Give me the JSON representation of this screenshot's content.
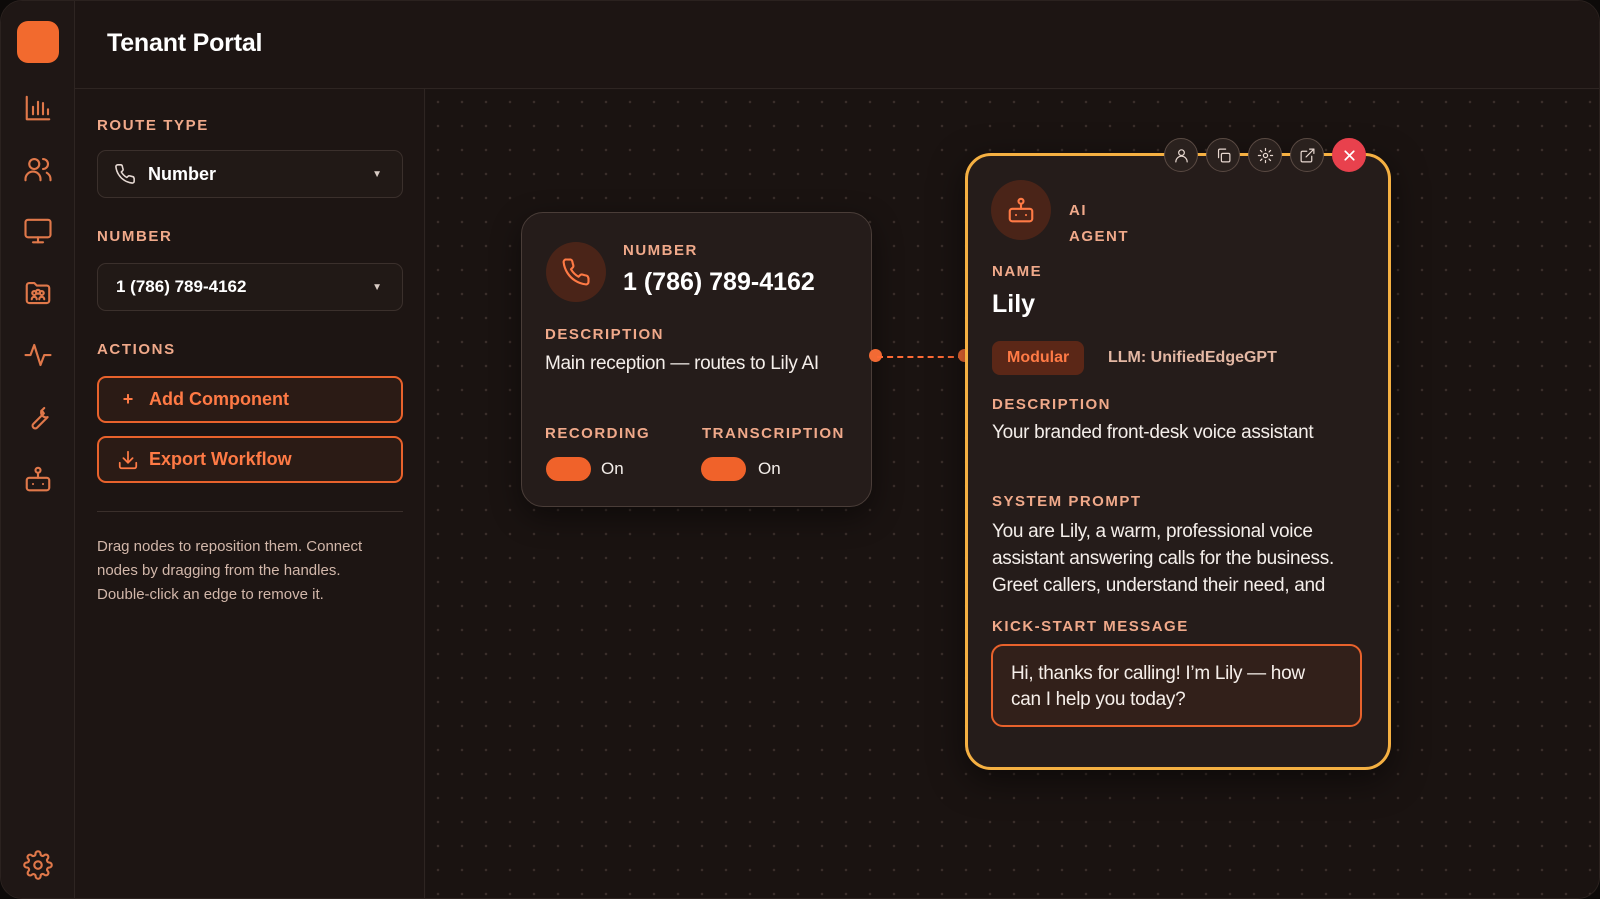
{
  "header": {
    "title": "Tenant Portal"
  },
  "rail": {
    "items": [
      "analytics",
      "users",
      "monitor",
      "team-folder",
      "activity",
      "tools",
      "agents"
    ],
    "footer": "settings"
  },
  "panel": {
    "route_type_label": "ROUTE TYPE",
    "route_type_value": "Number",
    "number_label": "NUMBER",
    "number_value": "1 (786) 789-4162",
    "actions_label": "ACTIONS",
    "add_component": "Add Component",
    "add_component_icon": "+",
    "export_workflow": "Export Workflow",
    "hint": "Drag nodes to reposition them. Connect nodes by dragging from the handles. Double-click an edge to remove it."
  },
  "number_node": {
    "type_label": "NUMBER",
    "phone": "1 (786) 789-4162",
    "description_label": "DESCRIPTION",
    "description": "Main reception — routes to Lily AI",
    "recording_label": "RECORDING",
    "recording_state": "On",
    "transcription_label": "TRANSCRIPTION",
    "transcription_state": "On"
  },
  "agent_node": {
    "type_line1": "AI",
    "type_line2": "AGENT",
    "name_label": "NAME",
    "name": "Lily",
    "chip_modular": "Modular",
    "chip_llm": "LLM: UnifiedEdgeGPT",
    "description_label": "DESCRIPTION",
    "description": "Your branded front-desk voice assistant",
    "system_prompt_label": "SYSTEM PROMPT",
    "system_prompt_line1": "You are Lily, a warm, professional voice",
    "system_prompt_line2": "assistant answering calls for the business.",
    "system_prompt_line3": "Greet callers, understand their need, and",
    "kickstart_label": "KICK-START MESSAGE",
    "kickstart_line1": "Hi, thanks for calling! I’m Lily — how",
    "kickstart_line2": "can I help you today?"
  },
  "colors": {
    "accent": "#f0622a",
    "agent_border": "#f5b042",
    "close": "#e8414d",
    "background": "#1b1412"
  }
}
